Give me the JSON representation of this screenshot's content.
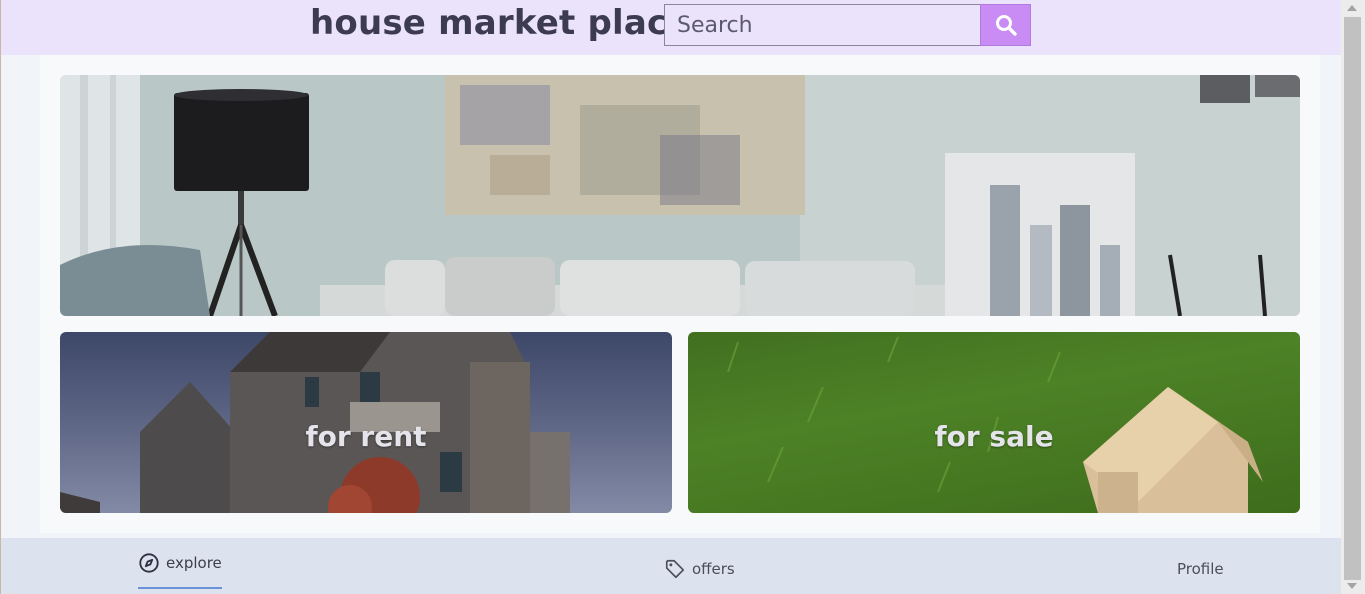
{
  "header": {
    "title": "house market place",
    "search_placeholder": "Search"
  },
  "hero": {
    "alt": "living room"
  },
  "categories": [
    {
      "label": "for rent"
    },
    {
      "label": "for sale"
    }
  ],
  "nav": {
    "explore": "explore",
    "offers": "offers",
    "profile": "Profile",
    "active": "explore"
  },
  "colors": {
    "header_bg": "#ebe2fb",
    "accent": "#c88cf4",
    "nav_bg": "#dde3ee",
    "active_underline": "#6a93d8"
  }
}
